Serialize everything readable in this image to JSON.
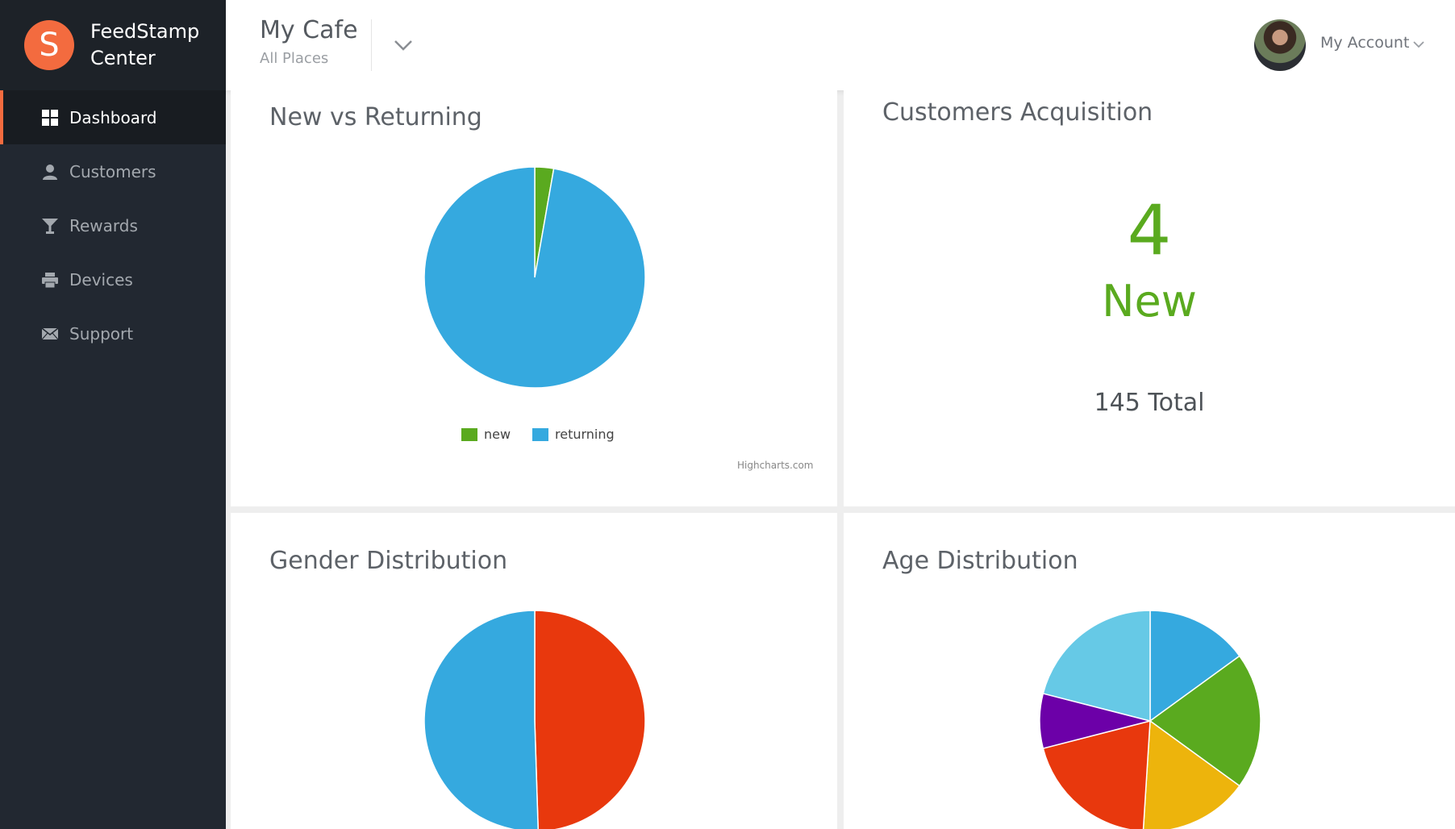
{
  "app": {
    "brand_line1": "FeedStamp",
    "brand_line2": "Center",
    "logo_letter": "S",
    "accent": "#f36b3f"
  },
  "sidebar": {
    "items": [
      {
        "label": "Dashboard",
        "icon": "dashboard-grid-icon",
        "active": true
      },
      {
        "label": "Customers",
        "icon": "user-icon",
        "active": false
      },
      {
        "label": "Rewards",
        "icon": "cocktail-glass-icon",
        "active": false
      },
      {
        "label": "Devices",
        "icon": "printer-icon",
        "active": false
      },
      {
        "label": "Support",
        "icon": "envelope-icon",
        "active": false
      }
    ]
  },
  "header": {
    "place_name": "My Cafe",
    "place_sub": "All Places",
    "account_label": "My Account"
  },
  "cards": {
    "new_vs_returning": {
      "title": "New vs Returning",
      "credits": "Highcharts.com"
    },
    "acquisition": {
      "title": "Customers Acquisition",
      "new_count": "4",
      "new_label": "New",
      "total_label": "145 Total"
    },
    "gender": {
      "title": "Gender Distribution"
    },
    "age": {
      "title": "Age Distribution"
    }
  },
  "chart_data": [
    {
      "type": "pie",
      "title": "New vs Returning",
      "legend": "bottom-center",
      "slices": [
        {
          "name": "new",
          "value": 4,
          "color": "#5aaa1f"
        },
        {
          "name": "returning",
          "value": 141,
          "color": "#35a9df"
        }
      ]
    },
    {
      "type": "pie",
      "title": "Gender Distribution",
      "slices": [
        {
          "value": 49.5,
          "color": "#e8380d"
        },
        {
          "value": 50.5,
          "color": "#35a9df"
        }
      ]
    },
    {
      "type": "pie",
      "title": "Age Distribution",
      "slices": [
        {
          "value": 15,
          "color": "#35a9df"
        },
        {
          "value": 20,
          "color": "#5aaa1f"
        },
        {
          "value": 16,
          "color": "#edb40c"
        },
        {
          "value": 20,
          "color": "#e8380d"
        },
        {
          "value": 8,
          "color": "#6c00a8"
        },
        {
          "value": 21,
          "color": "#66c9e6"
        }
      ]
    }
  ]
}
